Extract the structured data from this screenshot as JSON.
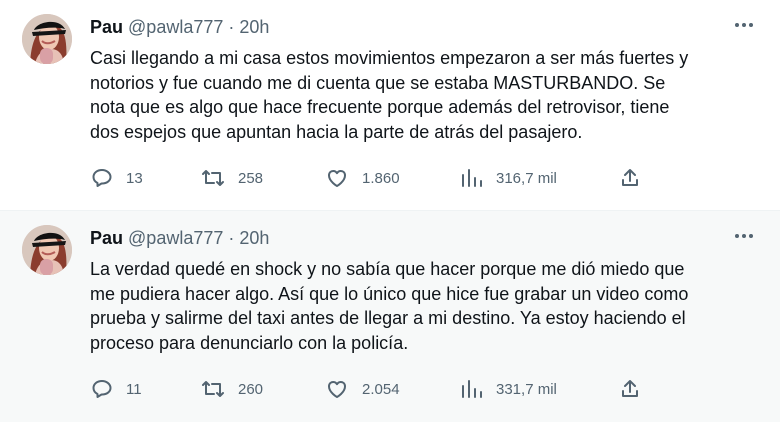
{
  "tweets": [
    {
      "author": {
        "name": "Pau",
        "handle": "@pawla777"
      },
      "separator": "·",
      "time": "20h",
      "text": "Casi llegando a mi casa estos movimientos empezaron a ser más fuertes y\nnotorios y fue cuando me di cuenta que se estaba MASTURBANDO. Se\nnota que es algo que hace frecuente porque además del retrovisor, tiene\ndos espejos que apuntan hacia la parte de atrás del pasajero.",
      "stats": {
        "replies": "13",
        "retweets": "258",
        "likes": "1.860",
        "views": "316,7 mil"
      },
      "icons": {
        "more": "more-icon",
        "reply": "reply-icon",
        "retweet": "retweet-icon",
        "like": "heart-icon",
        "views": "views-icon",
        "share": "share-icon"
      }
    },
    {
      "author": {
        "name": "Pau",
        "handle": "@pawla777"
      },
      "separator": "·",
      "time": "20h",
      "text": "La verdad quedé en shock y no sabía que hacer porque me dió miedo que\nme pudiera hacer algo. Así que lo único que hice fue grabar un video como\nprueba y salirme del taxi antes de llegar a mi destino. Ya estoy haciendo el\nproceso para denunciarlo con la policía.",
      "stats": {
        "replies": "11",
        "retweets": "260",
        "likes": "2.054",
        "views": "331,7 mil"
      },
      "icons": {
        "more": "more-icon",
        "reply": "reply-icon",
        "retweet": "retweet-icon",
        "like": "heart-icon",
        "views": "views-icon",
        "share": "share-icon"
      }
    }
  ],
  "colors": {
    "text": "#0f1419",
    "secondary": "#536471",
    "background": "#ffffff",
    "highlight_background": "#f7f9f9"
  }
}
